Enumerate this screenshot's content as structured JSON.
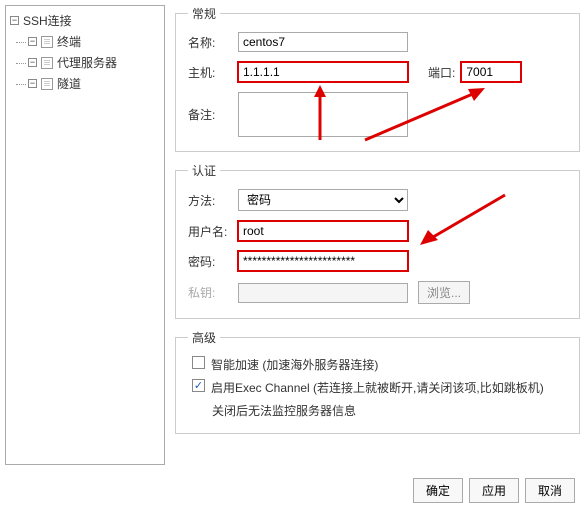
{
  "tree": {
    "root": "SSH连接",
    "items": [
      "终端",
      "代理服务器",
      "隧道"
    ]
  },
  "general": {
    "legend": "常规",
    "name_label": "名称:",
    "name_value": "centos7",
    "host_label": "主机:",
    "host_value": "1.1.1.1",
    "port_label": "端口:",
    "port_value": "7001",
    "remark_label": "备注:",
    "remark_value": ""
  },
  "auth": {
    "legend": "认证",
    "method_label": "方法:",
    "method_value": "密码",
    "user_label": "用户名:",
    "user_value": "root",
    "pass_label": "密码:",
    "pass_value": "************************",
    "key_label": "私钥:",
    "key_value": "",
    "browse_label": "浏览..."
  },
  "advanced": {
    "legend": "高级",
    "opt1": "智能加速 (加速海外服务器连接)",
    "opt2": "启用Exec Channel (若连接上就被断开,请关闭该项,比如跳板机)",
    "opt2_sub": "关闭后无法监控服务器信息"
  },
  "footer": {
    "ok": "确定",
    "apply": "应用",
    "cancel": "取消"
  }
}
